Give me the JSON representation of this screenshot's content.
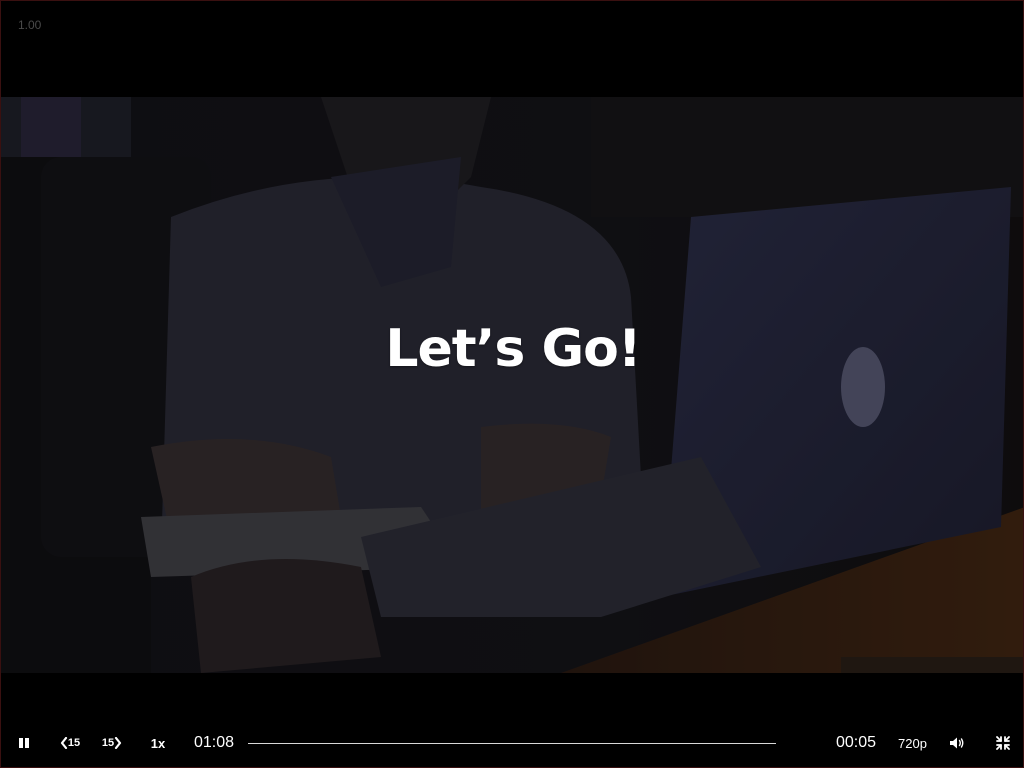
{
  "player": {
    "version_label": "1.00",
    "overlay_title": "Let’s Go!"
  },
  "controls": {
    "play_state": "playing",
    "skip_back_label": "15",
    "skip_forward_label": "15",
    "playback_rate": "1x",
    "elapsed_time": "01:08",
    "remaining_time": "00:05",
    "quality": "720p",
    "progress_fraction": 0.0
  },
  "icons": {
    "pause": "pause-icon",
    "skip_back": "skip-back-icon",
    "skip_forward": "skip-forward-icon",
    "volume": "volume-icon",
    "exit_fullscreen": "exit-fullscreen-icon"
  },
  "colors": {
    "background": "#000000",
    "foreground": "#ffffff",
    "progress_track": "#d8d8d8"
  }
}
